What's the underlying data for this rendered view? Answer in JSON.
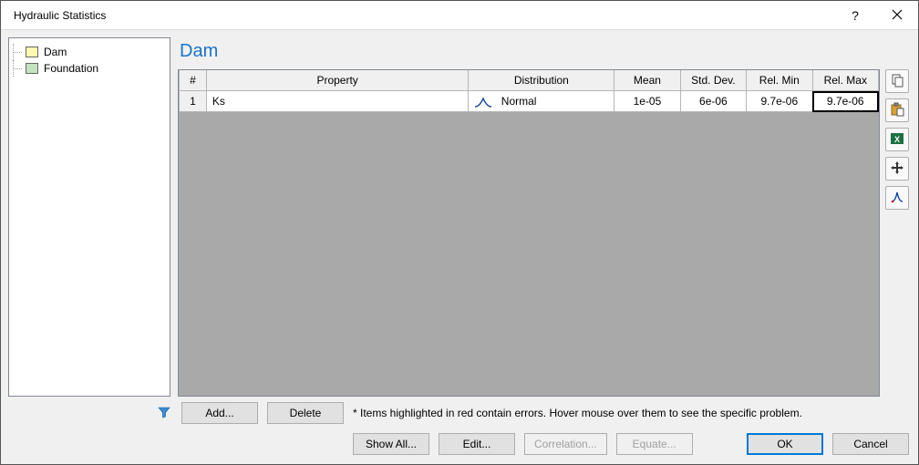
{
  "window": {
    "title": "Hydraulic Statistics"
  },
  "tree": {
    "items": [
      {
        "label": "Dam",
        "swatch": "swatch-yellow"
      },
      {
        "label": "Foundation",
        "swatch": "swatch-green"
      }
    ]
  },
  "heading": "Dam",
  "grid": {
    "columns": {
      "hash": "#",
      "property": "Property",
      "distribution": "Distribution",
      "mean": "Mean",
      "stddev": "Std. Dev.",
      "relmin": "Rel. Min",
      "relmax": "Rel. Max"
    },
    "rows": [
      {
        "num": "1",
        "property": "Ks",
        "distribution": "Normal",
        "mean": "1e-05",
        "stddev": "6e-06",
        "relmin": "9.7e-06",
        "relmax": "9.7e-06",
        "active_col": "relmax",
        "selected": true
      }
    ]
  },
  "hint": "* Items highlighted in red contain errors. Hover mouse over them to see the specific problem.",
  "buttons": {
    "add": "Add...",
    "delete": "Delete",
    "showall": "Show All...",
    "edit": "Edit...",
    "correlation": "Correlation...",
    "equate": "Equate...",
    "ok": "OK",
    "cancel": "Cancel"
  },
  "tooltips": {
    "copy": "copy-icon",
    "paste": "paste-icon",
    "excel": "excel-icon",
    "move": "move-icon",
    "fit": "distribution-fit-icon"
  }
}
